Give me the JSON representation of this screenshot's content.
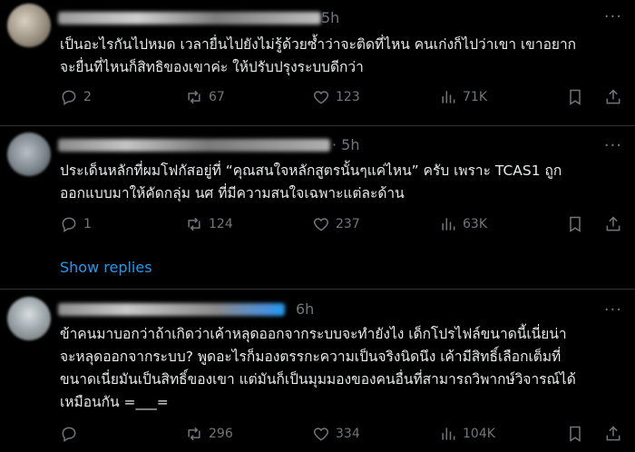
{
  "tweets": [
    {
      "time": "5h",
      "text": "เป็นอะไรกันไปหมด เวลายื่นไปยังไม่รู้ด้วยซ้ำว่าจะติดที่ไหน คนเก่งก็ไปว่าเขา เขาอยาก\nจะยื่นที่ไหนก็สิทธิของเขาค่ะ ให้ปรับปรุงระบบดีกว่า",
      "replies": "2",
      "reposts": "67",
      "likes": "123",
      "views": "71K"
    },
    {
      "time": "5h",
      "text": "ประเด็นหลักที่ผมโฟกัสอยู่ที่ “คุณสนใจหลักสูตรนั้นๆแค่ไหน” ครับ เพราะ TCAS1 ถูก\nออกแบบมาให้คัดกลุ่ม นศ ที่มีความสนใจเฉพาะแต่ละด้าน",
      "replies": "1",
      "reposts": "124",
      "likes": "237",
      "views": "63K"
    },
    {
      "time": "6h",
      "text": "ข้าคนมาบอกว่าถ้าเกิดว่าเค้าหลุดออกจากระบบจะทำยังไง เด็กโปรไฟล์ขนาดนี้เนี่ยน่า\nจะหลุดออกจากระบบ? พูดอะไรก็มองตรรกะความเป็นจริงนิดนึง เค้ามีสิทธิ์เลือกเต็มที่\nขนาดเนี่ยมันเป็นสิทธิ์ของเขา แต่มันก็เป็นมุมมองของคนอื่นที่สามารถวิพากษ์วิจารณ์ได้\nเหมือนกัน =___=",
      "replies": "",
      "reposts": "296",
      "likes": "334",
      "views": "104K"
    }
  ],
  "show_replies_label": "Show replies",
  "more_label": "···",
  "colors": {
    "link": "#1d9bf0",
    "muted": "#71767b",
    "text": "#e7e9ea",
    "bg": "#000000"
  },
  "icons": [
    "reply-icon",
    "repost-icon",
    "like-icon",
    "views-icon",
    "bookmark-icon",
    "share-icon"
  ]
}
